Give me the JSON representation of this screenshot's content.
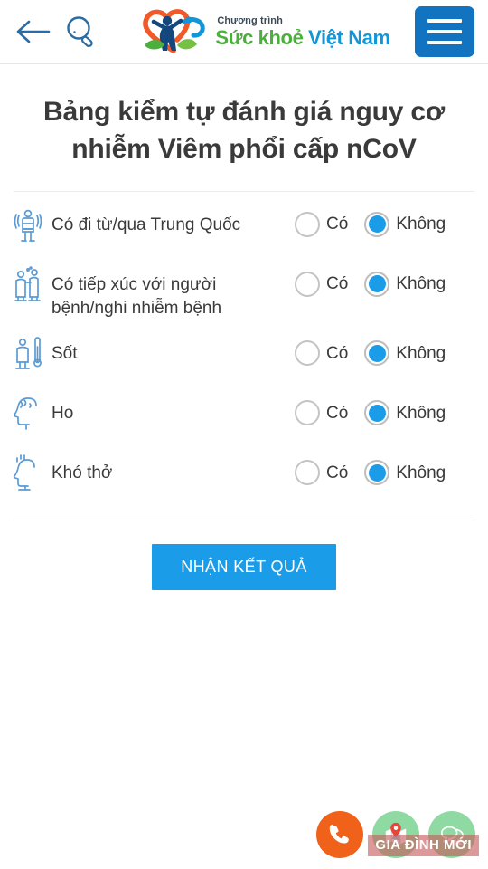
{
  "header": {
    "back_icon": "back-arrow-icon",
    "search_icon": "search-icon",
    "menu_icon": "hamburger-menu-icon",
    "logo": {
      "tagline": "Chương trình",
      "name_part1": "Sức khoẻ ",
      "name_part2": "Việt Nam",
      "mark": "health-vietnam-logo-icon",
      "color_green": "#4caf3d",
      "color_blue": "#1296d8"
    },
    "menu_button_color": "#1273c0"
  },
  "main": {
    "title": "Bảng kiểm tự đánh giá nguy cơ nhiễm Viêm phổi cấp nCoV",
    "options": {
      "yes": "Có",
      "no": "Không"
    },
    "selected_color": "#1a9ce8",
    "questions": [
      {
        "icon": "body-scanner-person-icon",
        "label": "Có đi từ/qua Trung Quốc",
        "answer": "no"
      },
      {
        "icon": "two-people-contact-icon",
        "label": "Có tiếp xúc với người bệnh/nghi nhiễm bệnh",
        "answer": "no"
      },
      {
        "icon": "thermometer-fever-icon",
        "label": "Sốt",
        "answer": "no"
      },
      {
        "icon": "head-cough-icon",
        "label": "Ho",
        "answer": "no"
      },
      {
        "icon": "head-breathing-icon",
        "label": "Khó thở",
        "answer": "no"
      }
    ],
    "submit_label": "NHẬN KẾT QUẢ",
    "submit_color": "#1a9ce8"
  },
  "floating_actions": [
    {
      "name": "phone-fab",
      "icon": "phone-icon",
      "color": "#f0611a"
    },
    {
      "name": "map-fab",
      "icon": "map-pin-icon",
      "color": "#8fd9a3"
    },
    {
      "name": "chat-fab",
      "icon": "chat-bubble-icon",
      "color": "#8fd9a3"
    }
  ],
  "watermark": {
    "text": "GIA ĐÌNH MỚI",
    "color": "#c85a5a"
  }
}
